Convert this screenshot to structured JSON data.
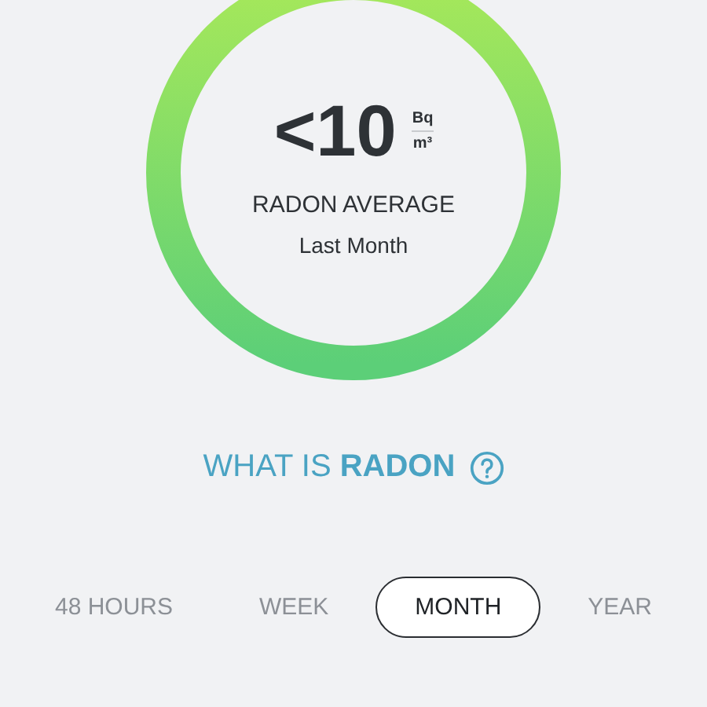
{
  "reading": {
    "value": "<10",
    "unit_numerator": "Bq",
    "unit_denominator": "m³",
    "label": "RADON AVERAGE",
    "period": "Last Month"
  },
  "info_link": {
    "text": "WHAT IS **RADON**"
  },
  "period_tabs": [
    {
      "label": "48 HOURS",
      "selected": false
    },
    {
      "label": "WEEK",
      "selected": false
    },
    {
      "label": "MONTH",
      "selected": true
    },
    {
      "label": "YEAR",
      "selected": false
    }
  ]
}
